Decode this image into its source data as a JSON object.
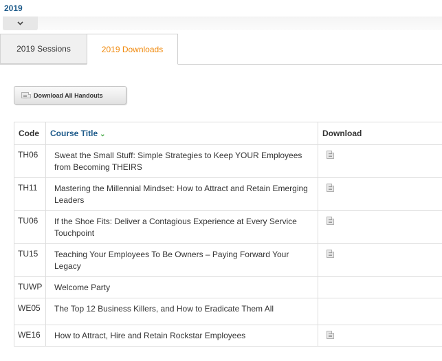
{
  "header": {
    "year": "2019"
  },
  "tabs": [
    {
      "label": "2019 Sessions",
      "active": false
    },
    {
      "label": "2019 Downloads",
      "active": true
    }
  ],
  "colors": {
    "accent_orange": "#f0880a",
    "link_blue": "#1d5a8a",
    "sort_green": "#44aa44"
  },
  "download_all": {
    "label": "Download All Handouts",
    "icon": "document-icon"
  },
  "table": {
    "headers": {
      "code": "Code",
      "title": "Course Title",
      "download": "Download"
    },
    "sorted_by": "Course Title",
    "rows": [
      {
        "code": "TH06",
        "title": "Sweat the Small Stuff: Simple Strategies to Keep YOUR Employees from Becoming THEIRS",
        "has_download": true
      },
      {
        "code": "TH11",
        "title": "Mastering the Millennial Mindset: How to Attract and Retain Emerging Leaders",
        "has_download": true
      },
      {
        "code": "TU06",
        "title": "If the Shoe Fits: Deliver a Contagious Experience at Every Service Touchpoint",
        "has_download": true
      },
      {
        "code": "TU15",
        "title": "Teaching Your Employees To Be Owners – Paying Forward Your Legacy",
        "has_download": true
      },
      {
        "code": "TUWP",
        "title": "Welcome Party",
        "has_download": false
      },
      {
        "code": "WE05",
        "title": "The Top 12 Business Killers, and How to Eradicate Them All",
        "has_download": false
      },
      {
        "code": "WE16",
        "title": "How to Attract, Hire and Retain Rockstar Employees",
        "has_download": true
      }
    ]
  }
}
